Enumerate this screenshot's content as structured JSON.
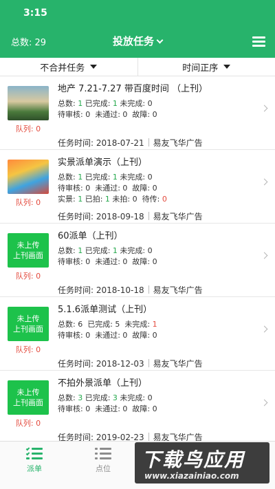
{
  "status_bar": {
    "time": "3:15"
  },
  "nav": {
    "total_label": "总数: 29",
    "title": "投放任务",
    "menu_icon": "hamburger-menu-icon"
  },
  "filters": [
    {
      "label": "不合并任务"
    },
    {
      "label": "时间正序"
    }
  ],
  "colors": {
    "brand": "#27b36b",
    "count_green": "#23a84b",
    "alert_red": "#e34a3d",
    "placeholder_green": "#1dc24b"
  },
  "tasks": [
    {
      "title": "地产 7.21-7.27 带百度时间 （上刊）",
      "thumb_type": "photo",
      "queue": "队列: 0",
      "lines": [
        [
          {
            "t": "总数: "
          },
          {
            "t": "1",
            "c": "green"
          },
          {
            "t": " 已完成: "
          },
          {
            "t": "1",
            "c": "green"
          },
          {
            "t": " 未完成: 0"
          }
        ],
        [
          {
            "t": "待审核: 0  未通过: 0  故障: 0"
          }
        ]
      ],
      "task_time": "任务时间: 2018-07-21",
      "company": "易友飞华广告"
    },
    {
      "title": "实景派单演示（上刊）",
      "thumb_type": "poster",
      "queue": "队列: 0",
      "lines": [
        [
          {
            "t": "总数: "
          },
          {
            "t": "1",
            "c": "green"
          },
          {
            "t": " 已完成: "
          },
          {
            "t": "1",
            "c": "green"
          },
          {
            "t": " 未完成: 0"
          }
        ],
        [
          {
            "t": "待审核: 0  未通过: 0  故障: 0"
          }
        ],
        [
          {
            "t": "实景: "
          },
          {
            "t": "1",
            "c": "green"
          },
          {
            "t": " 已拍: "
          },
          {
            "t": "1",
            "c": "green"
          },
          {
            "t": " 未拍: 0  待传: "
          },
          {
            "t": "0",
            "c": "red"
          }
        ]
      ],
      "task_time": "任务时间: 2018-09-18",
      "company": "易友飞华广告"
    },
    {
      "title": "60派单（上刊）",
      "thumb_type": "placeholder",
      "thumb_line1": "未上传",
      "thumb_line2": "上刊画面",
      "queue": "队列: 0",
      "lines": [
        [
          {
            "t": "总数: "
          },
          {
            "t": "1",
            "c": "green"
          },
          {
            "t": " 已完成: "
          },
          {
            "t": "1",
            "c": "green"
          },
          {
            "t": " 未完成: 0"
          }
        ],
        [
          {
            "t": "待审核: 0  未通过: 0  故障: 0"
          }
        ]
      ],
      "task_time": "任务时间: 2018-10-18",
      "company": "易友飞华广告"
    },
    {
      "title": "5.1.6派单测试（上刊）",
      "thumb_type": "placeholder",
      "thumb_line1": "未上传",
      "thumb_line2": "上刊画面",
      "queue": "队列: 0",
      "lines": [
        [
          {
            "t": "总数: 6  已完成: 5  未完成: "
          },
          {
            "t": "1",
            "c": "red"
          }
        ],
        [
          {
            "t": "待审核: 0  未通过: 0  故障: 0"
          }
        ]
      ],
      "task_time": "任务时间: 2018-12-03",
      "company": "易友飞华广告"
    },
    {
      "title": "不拍外景派单（上刊）",
      "thumb_type": "placeholder",
      "thumb_line1": "未上传",
      "thumb_line2": "上刊画面",
      "queue": "队列: 0",
      "lines": [
        [
          {
            "t": "总数: "
          },
          {
            "t": "3",
            "c": "green"
          },
          {
            "t": " 已完成: "
          },
          {
            "t": "3",
            "c": "green"
          },
          {
            "t": " 未完成: 0"
          }
        ],
        [
          {
            "t": "待审核: 0  未通过: 0  故障: 0"
          }
        ]
      ],
      "task_time": "任务时间: 2019-02-23",
      "company": "易友飞华广告"
    }
  ],
  "tabbar": [
    {
      "label": "派单",
      "icon": "checklist-icon",
      "active": true
    },
    {
      "label": "点位",
      "icon": "list-icon",
      "active": false
    }
  ],
  "watermark": {
    "main": "下载鸟应用",
    "sub": "www.xiazainiao.com"
  }
}
